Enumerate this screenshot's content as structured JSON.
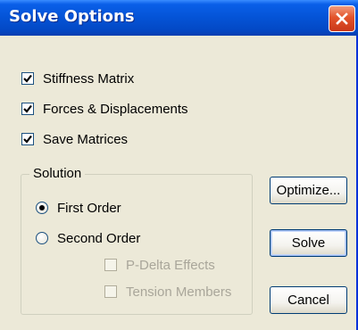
{
  "window": {
    "title": "Solve Options"
  },
  "options": {
    "stiffness_matrix": {
      "label": "Stiffness Matrix",
      "checked": true
    },
    "forces_displacements": {
      "label": "Forces & Displacements",
      "checked": true
    },
    "save_matrices": {
      "label": "Save Matrices",
      "checked": true
    }
  },
  "solution": {
    "group_label": "Solution",
    "first_order": {
      "label": "First Order",
      "selected": true
    },
    "second_order": {
      "label": "Second Order",
      "selected": false
    },
    "p_delta": {
      "label": "P-Delta Effects",
      "checked": false,
      "enabled": false
    },
    "tension_members": {
      "label": "Tension Members",
      "checked": false,
      "enabled": false
    }
  },
  "buttons": {
    "optimize": "Optimize...",
    "solve": "Solve",
    "cancel": "Cancel"
  },
  "icons": {
    "close": "close-icon",
    "check": "checkmark-icon"
  },
  "colors": {
    "title_bar": "#0453d6",
    "close_button": "#e3532a",
    "dialog_background": "#ece9d8",
    "disabled_text": "#a9a69a"
  }
}
